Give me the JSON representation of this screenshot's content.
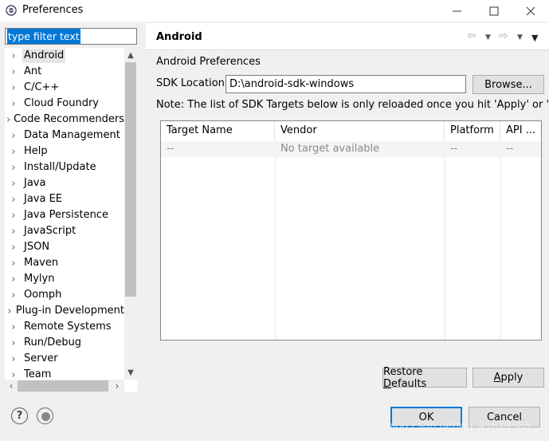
{
  "window": {
    "title": "Preferences"
  },
  "filter": {
    "value": "type filter text"
  },
  "tree": {
    "items": [
      "Android",
      "Ant",
      "C/C++",
      "Cloud Foundry",
      "Code Recommenders",
      "Data Management",
      "Help",
      "Install/Update",
      "Java",
      "Java EE",
      "Java Persistence",
      "JavaScript",
      "JSON",
      "Maven",
      "Mylyn",
      "Oomph",
      "Plug-in Development",
      "Remote Systems",
      "Run/Debug",
      "Server",
      "Team"
    ],
    "selected": "Android"
  },
  "page": {
    "title": "Android",
    "preferences_label": "Android Preferences",
    "sdk_label": "SDK Location:",
    "sdk_value": "D:\\android-sdk-windows",
    "browse_label": "Browse...",
    "note": "Note: The list of SDK Targets below is only reloaded once you hit 'Apply' or 'OK'."
  },
  "table": {
    "columns": [
      "Target Name",
      "Vendor",
      "Platform",
      "API ..."
    ],
    "row": [
      "--",
      "No target available",
      "--",
      "--"
    ]
  },
  "buttons": {
    "restore": "Restore Defaults",
    "apply": "Apply",
    "ok": "OK",
    "cancel": "Cancel"
  },
  "watermark": "https://blog.csdn.net/qq_41879385"
}
